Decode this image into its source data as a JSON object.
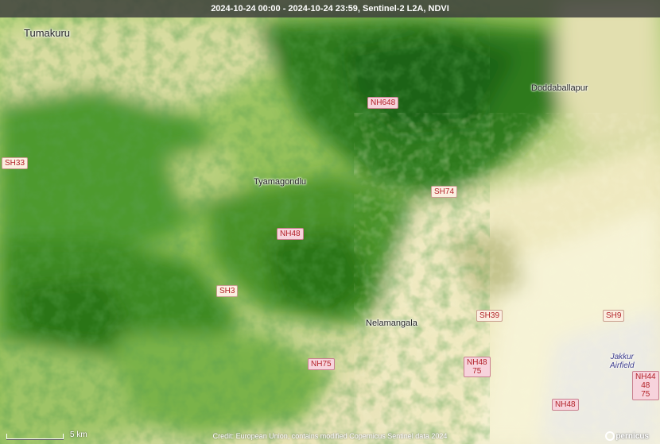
{
  "header": {
    "title": "2024-10-24 00:00 - 2024-10-24 23:59, Sentinel-2 L2A, NDVI"
  },
  "places": {
    "tumakuru": "Tumakuru",
    "doddaballapur": "Doddaballapur",
    "tyamagondlu": "Tyamagondlu",
    "nelamangala": "Nelamangala",
    "jakkur_line1": "Jakkur",
    "jakkur_line2": "Airfield"
  },
  "roads": {
    "nh648": "NH648",
    "sh33": "SH33",
    "sh74": "SH74",
    "nh48": "NH48",
    "sh3": "SH3",
    "sh39": "SH39",
    "sh9": "SH9",
    "nh75": "NH75",
    "nh48_75_a": "NH48",
    "nh48_75_b": "75",
    "nh44_a": "NH44",
    "nh44_b": "48",
    "nh44_c": "75",
    "nh48_south": "NH48"
  },
  "scale": {
    "label": "5 km"
  },
  "credit": "Credit: European Union, contains modified Copernicus Sentinel data 2024",
  "logo": {
    "text": "pernicus"
  },
  "colors": {
    "vegetation_dense": "#1e6b1e",
    "vegetation_mid": "#6aa83a",
    "vegetation_low": "#c7d98a",
    "bare": "#efe6b8",
    "urban": "#f6f2cf",
    "water_text": "#3a3a8a"
  }
}
